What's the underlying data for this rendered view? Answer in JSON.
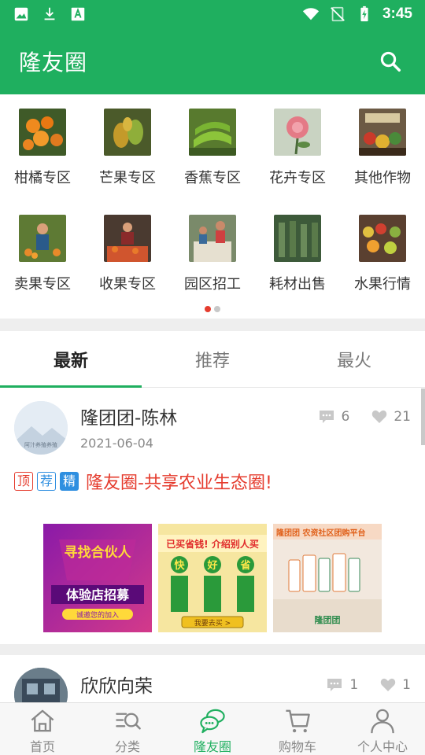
{
  "status_bar": {
    "time": "3:45"
  },
  "app_bar": {
    "title": "隆友圈"
  },
  "categories": [
    {
      "label": "柑橘专区",
      "thumb_color": "#e07a1f"
    },
    {
      "label": "芒果专区",
      "thumb_color": "#8a9a3a"
    },
    {
      "label": "香蕉专区",
      "thumb_color": "#6d9a2e"
    },
    {
      "label": "花卉专区",
      "thumb_color": "#e58c8c"
    },
    {
      "label": "其他作物",
      "thumb_color": "#7a5a3a"
    },
    {
      "label": "卖果专区",
      "thumb_color": "#8a8a3a"
    },
    {
      "label": "收果专区",
      "thumb_color": "#c0552e"
    },
    {
      "label": "园区招工",
      "thumb_color": "#6a7a5a"
    },
    {
      "label": "耗材出售",
      "thumb_color": "#4a6a4a"
    },
    {
      "label": "水果行情",
      "thumb_color": "#d0a030"
    }
  ],
  "tabs": [
    {
      "label": "最新",
      "active": true
    },
    {
      "label": "推荐",
      "active": false
    },
    {
      "label": "最火",
      "active": false
    }
  ],
  "post1": {
    "author": "隆团团-陈林",
    "date": "2021-06-04",
    "comments": "6",
    "likes": "21",
    "tags": [
      "顶",
      "荐",
      "精"
    ],
    "title": "隆友圈-共享农业生态圈!",
    "avatar_text": "阿汁养殖养殖",
    "images": [
      {
        "headline": "寻找合伙人",
        "subline": "体验店招募",
        "caption": "诚邀您的加入"
      },
      {
        "headline": "已买省钱! 介绍别人买",
        "badges": [
          "快",
          "好",
          "省"
        ],
        "button": "我要去买 >"
      },
      {
        "headline": "隆团团 农资社区团购平台",
        "footer": "隆团团"
      }
    ]
  },
  "post2": {
    "author": "欣欣向荣",
    "comments": "1",
    "likes": "1"
  },
  "bottom_nav": [
    {
      "label": "首页",
      "icon": "home-icon",
      "active": false
    },
    {
      "label": "分类",
      "icon": "category-search-icon",
      "active": false
    },
    {
      "label": "隆友圈",
      "icon": "chat-bubbles-icon",
      "active": true
    },
    {
      "label": "购物车",
      "icon": "cart-icon",
      "active": false
    },
    {
      "label": "个人中心",
      "icon": "user-icon",
      "active": false
    }
  ],
  "colors": {
    "brand": "#1faf5f",
    "accent_red": "#e53c2e",
    "tag_blue": "#2f8fe0"
  }
}
